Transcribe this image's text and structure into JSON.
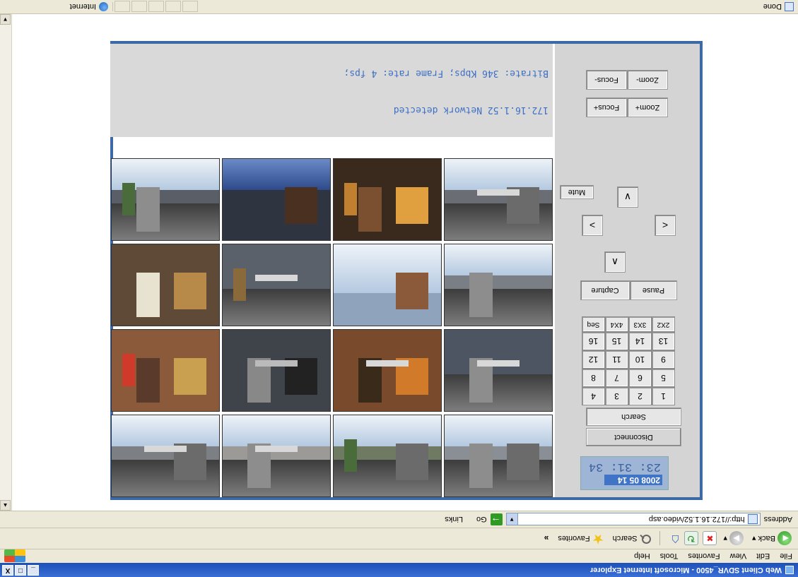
{
  "window": {
    "title": "Web Client SDVR_4500 - Microsoft Internet Explorer",
    "controls": {
      "minimize": "_",
      "maximize": "□",
      "close": "X"
    }
  },
  "menu": [
    "File",
    "Edit",
    "View",
    "Favorites",
    "Tools",
    "Help"
  ],
  "toolbar": {
    "back": "Back",
    "search": "Search",
    "favorites": "Favorites",
    "more": "»"
  },
  "address": {
    "label": "Address",
    "url": "http://172.16.1.52/video.asp",
    "go": "Go",
    "links": "Links"
  },
  "app": {
    "clock": {
      "date": "2008 05 14",
      "time": "23: 31: 34"
    },
    "buttons": {
      "disconnect": "Disconnect",
      "search": "Search",
      "pause": "Pause",
      "capture": "Capture",
      "mute": "Mute",
      "zoom_plus": "Zoom+",
      "focus_plus": "Focus+",
      "zoom_minus": "Zoom-",
      "focus_minus": "Focus-"
    },
    "camera_buttons": [
      "1",
      "2",
      "3",
      "4",
      "5",
      "6",
      "7",
      "8",
      "9",
      "10",
      "11",
      "12",
      "13",
      "14",
      "15",
      "16"
    ],
    "layouts": [
      "2X2",
      "3X3",
      "4X4",
      "Seq"
    ],
    "ptz": {
      "up": "∧",
      "down": "∨",
      "left": "<",
      "right": ">"
    },
    "info": {
      "network": "172.16.1.52 Network detected",
      "stream": "Bitrate: 346 Kbps; Frame rate: 4 fps;"
    }
  },
  "status": {
    "text": "Done",
    "zone": "Internet"
  }
}
